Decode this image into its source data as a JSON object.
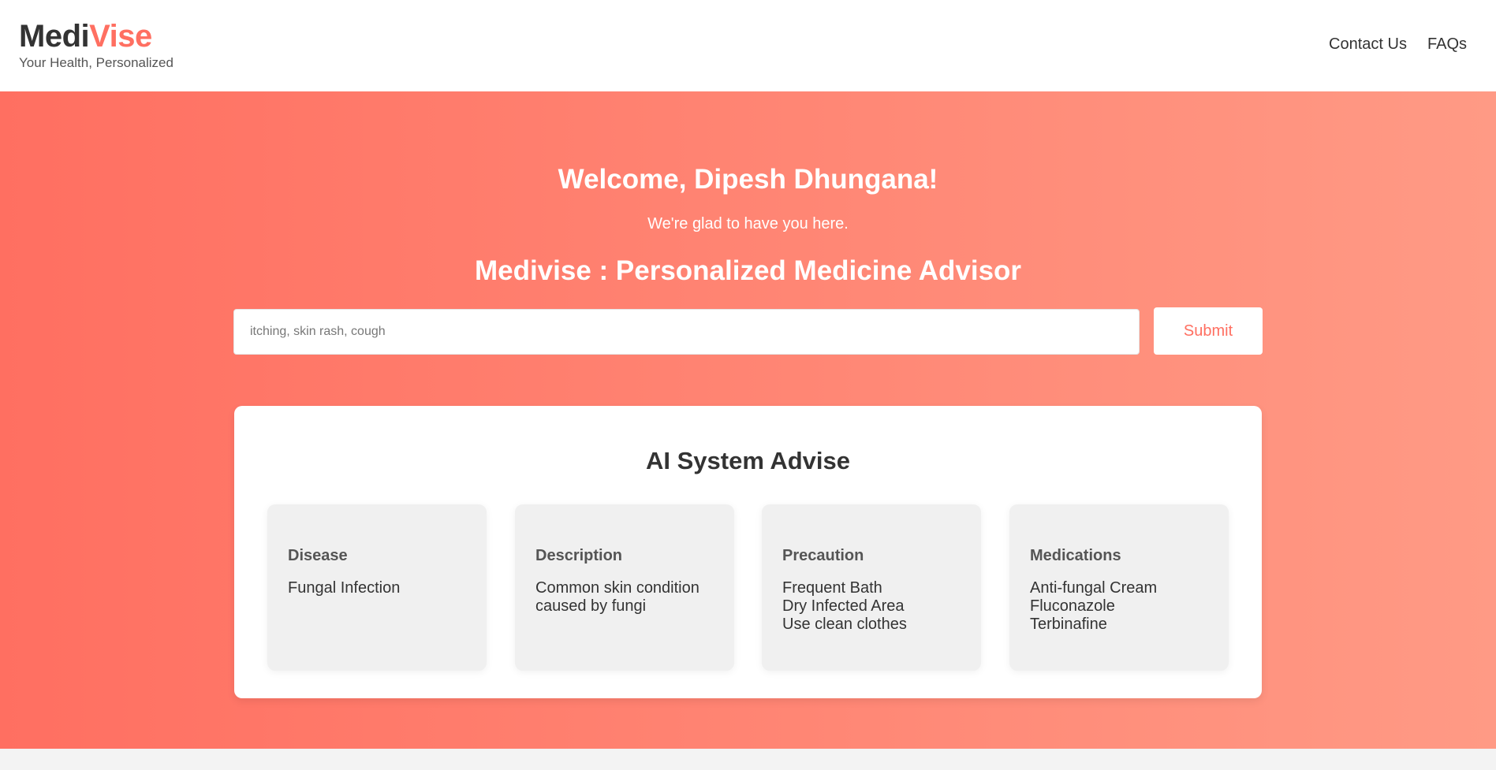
{
  "header": {
    "brand_part1": "Medi",
    "brand_part2": "Vise",
    "tagline": "Your Health, Personalized",
    "nav": [
      {
        "label": "Contact Us"
      },
      {
        "label": "FAQs"
      }
    ]
  },
  "hero": {
    "welcome": "Welcome, Dipesh Dhungana!",
    "subtitle": "We're glad to have you here.",
    "app_title": "Medivise : Personalized Medicine Advisor",
    "search": {
      "placeholder": "itching, skin rash, cough",
      "value": ""
    },
    "submit_label": "Submit"
  },
  "advise": {
    "title": "AI System Advise",
    "cards": [
      {
        "title": "Disease",
        "lines": [
          "Fungal Infection"
        ]
      },
      {
        "title": "Description",
        "lines": [
          "Common skin condition",
          "caused by fungi"
        ]
      },
      {
        "title": "Precaution",
        "lines": [
          "Frequent Bath",
          "Dry Infected Area",
          "Use clean clothes"
        ]
      },
      {
        "title": "Medications",
        "lines": [
          "Anti-fungal Cream",
          "Fluconazole",
          "Terbinafine"
        ]
      }
    ]
  },
  "colors": {
    "accent": "#ff6f61",
    "gradient_end": "#ff9a85",
    "text_dark": "#333333"
  }
}
